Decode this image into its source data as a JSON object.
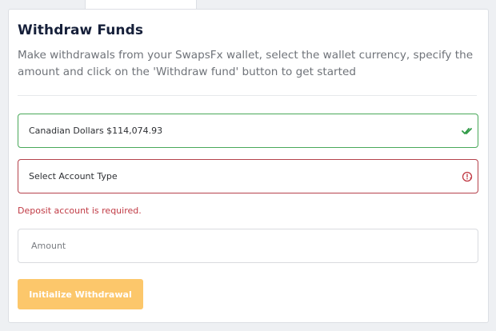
{
  "form": {
    "title": "Withdraw Funds",
    "description": "Make withdrawals from your SwapsFx wallet, select the wallet currency, specify the amount and click on the 'Withdraw fund' button to get started",
    "wallet_select": {
      "value": "Canadian Dollars $114,074.93",
      "status": "valid",
      "icon": "double-check-icon"
    },
    "account_type_select": {
      "value": "Select Account Type",
      "status": "invalid",
      "icon": "error-icon"
    },
    "account_error": "Deposit account is required.",
    "amount_input": {
      "placeholder": "Amount",
      "value": ""
    },
    "submit_label": "Initialize Withdrawal"
  },
  "colors": {
    "valid_border": "#49a85a",
    "invalid_border": "#b5424c",
    "error_text": "#c03a44",
    "button_bg": "#fcc76b",
    "title": "#16203a"
  }
}
